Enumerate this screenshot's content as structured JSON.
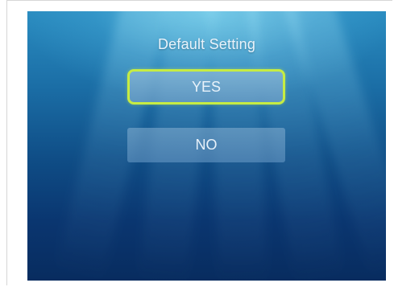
{
  "dialog": {
    "title": "Default Setting",
    "options": [
      {
        "label": "YES",
        "selected": true
      },
      {
        "label": "NO",
        "selected": false
      }
    ]
  },
  "colors": {
    "selection_border": "#c6ec43",
    "background_top": "#2a8cc0",
    "background_bottom": "#082c5f",
    "text": "#e9f3fb"
  }
}
